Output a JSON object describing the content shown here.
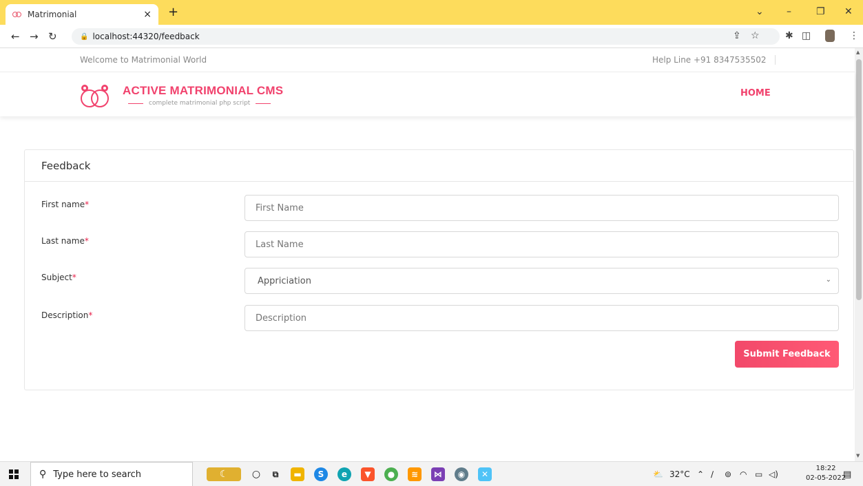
{
  "browser": {
    "tab_title": "Matrimonial",
    "tab_close": "×",
    "new_tab": "+",
    "url": "localhost:44320/feedback"
  },
  "site": {
    "welcome": "Welcome to Matrimonial World",
    "helpline": "Help Line +91 8347535502",
    "brand": "ACTIVE MATRIMONIAL CMS",
    "tagline": "complete matrimonial php script",
    "nav_home": "HOME",
    "brand_color": "#f1426d"
  },
  "form": {
    "title": "Feedback",
    "required_mark": "*",
    "fields": [
      {
        "label": "First name",
        "placeholder": "First Name"
      },
      {
        "label": "Last name",
        "placeholder": "Last Name"
      },
      {
        "label": "Subject",
        "value": "Appriciation"
      },
      {
        "label": "Description",
        "placeholder": "Description"
      }
    ],
    "submit_label": "Submit Feedback"
  },
  "taskbar": {
    "search_placeholder": "Type here to search",
    "weather": "32°C",
    "time": "18:22",
    "date": "02-05-2022"
  }
}
